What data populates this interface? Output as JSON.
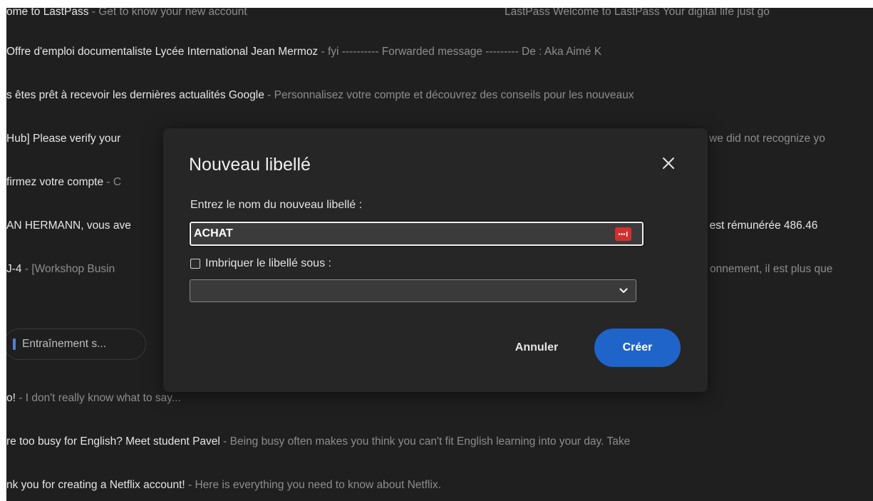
{
  "inbox": {
    "rows": [
      {
        "subject": "ome to LastPass",
        "snippet": " - Get to know your new account",
        "right_text": "LastPass Welcome to LastPass Your digital life just go"
      },
      {
        "subject": " Offre d'emploi documentaliste Lycée International Jean Mermoz",
        "snippet": " - fyi ---------- Forwarded message --------- De : Aka Aimé K"
      },
      {
        "subject": "s êtes prêt à recevoir les dernières actualités Google",
        "snippet": " - Personnalisez votre compte et découvrez des conseils pour les nouveaux"
      },
      {
        "subject": "Hub] Please verify your ",
        "snippet": "",
        "right_text": "we did not recognize yo"
      },
      {
        "subject": "firmez votre compte",
        "snippet": " - C"
      },
      {
        "subject": "AN HERMANN, vous ave",
        "snippet": "",
        "right_text": "us est rémunérée 486.46"
      },
      {
        "subject": " J-4",
        "snippet": " - [Workshop Busin",
        "right_text": "onnement, il est plus que"
      },
      {
        "subject": "o!",
        "snippet": " - I don't really know what to say..."
      },
      {
        "subject": "re too busy for English? Meet student Pavel",
        "snippet": " - Being busy often makes you think you can't fit English learning into your day. Take"
      },
      {
        "subject": "nk you for creating a Netflix account!",
        "snippet": " - Here is everything you need to know about Netflix."
      }
    ],
    "chip_label": "Entraînement s..."
  },
  "dialog": {
    "title": "Nouveau libellé",
    "name_label": "Entrez le nom du nouveau libellé :",
    "name_value": "ACHAT",
    "nest_label": "Imbriquer le libellé sous :",
    "nest_checked": false,
    "parent_select_value": "",
    "cancel_label": "Annuler",
    "create_label": "Créer"
  },
  "colors": {
    "background": "#1f1f1f",
    "dialog_bg": "#262626",
    "primary_button": "#1f64c9",
    "password_icon": "#d32f2f"
  },
  "icons": {
    "close": "close-icon",
    "password_manager": "password-manager-icon",
    "select_chevron": "chevron-down-icon"
  }
}
